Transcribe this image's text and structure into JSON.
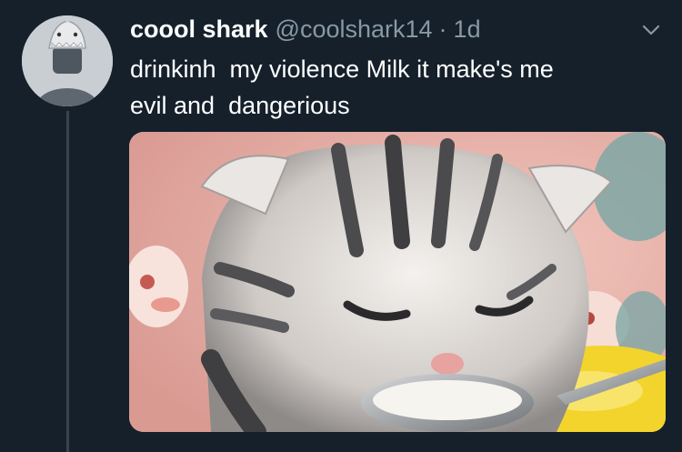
{
  "tweet": {
    "display_name": "coool shark",
    "handle": "@coolshark14",
    "separator": "·",
    "time": "1d",
    "text": "drinkinh  my violence Milk it make's me\nevil and  dangerious"
  },
  "icons": {
    "avatar": "shark-hat-avatar-icon",
    "menu": "chevron-down-icon"
  },
  "colors": {
    "background": "#15202b",
    "secondary_text": "#8899a6",
    "thread_line": "#38444d"
  }
}
